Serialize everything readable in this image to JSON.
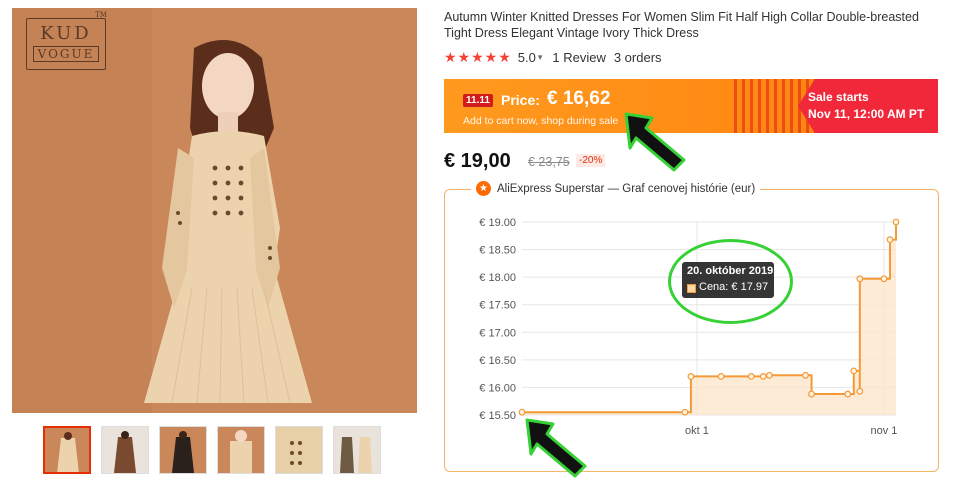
{
  "product": {
    "title": "Autumn Winter Knitted Dresses For Women Slim Fit Half High Collar Double-breasted Tight Dress Elegant Vintage Ivory Thick Dress",
    "brand_logo_top": "KUD",
    "brand_logo_bottom": "VOGUE",
    "brand_logo_mark": "TM",
    "rating_stars": "★★★★★",
    "rating_value": "5.0",
    "reviews": "1 Review",
    "orders": "3 orders",
    "thumbnails": [
      {
        "name": "thumb-1",
        "color": "#d9b48a"
      },
      {
        "name": "thumb-2",
        "color": "#7a4a30"
      },
      {
        "name": "thumb-3",
        "color": "#2a211c"
      },
      {
        "name": "thumb-4",
        "color": "#c9875a"
      },
      {
        "name": "thumb-5",
        "color": "#e7cfa8"
      },
      {
        "name": "thumb-6",
        "color": "#6f5a44"
      }
    ]
  },
  "sale_banner": {
    "tag": "11.11",
    "price_label": "Price:",
    "price_value": "€ 16,62",
    "subtitle": "Add to cart now, shop during sale",
    "sale_starts": "Sale starts",
    "sale_date": "Nov 11, 12:00 AM PT"
  },
  "pricing": {
    "current_price": "€ 19,00",
    "original_price": "€ 23,75",
    "discount": "-20%"
  },
  "price_history": {
    "badge_icon": "star-icon",
    "header": "AliExpress Superstar — Graf cenovej histórie (eur)",
    "tooltip_date": "20. október 2019",
    "tooltip_value": "Cena: € 17.97"
  },
  "colors": {
    "accent": "#ff9a1f",
    "sale_red": "#f0283a",
    "line": "#f29a38",
    "fill": "#fde6cc",
    "annotation": "#35d135"
  },
  "chart_data": {
    "type": "area",
    "title": "",
    "xlabel": "",
    "ylabel": "",
    "ylim": [
      15.5,
      19.0
    ],
    "yticks": [
      "€ 19.00",
      "€ 18.50",
      "€ 18.00",
      "€ 17.50",
      "€ 17.00",
      "€ 16.50",
      "€ 16.00",
      "€ 15.50"
    ],
    "xticks": [
      "okt 1",
      "nov 1"
    ],
    "x_range": [
      "2019-09-02",
      "2019-11-03"
    ],
    "series": [
      {
        "step": true,
        "points": [
          {
            "x": "2019-09-02",
            "y": 15.55
          },
          {
            "x": "2019-09-29",
            "y": 15.55
          },
          {
            "x": "2019-09-30",
            "y": 16.2
          },
          {
            "x": "2019-10-05",
            "y": 16.2
          },
          {
            "x": "2019-10-10",
            "y": 16.2
          },
          {
            "x": "2019-10-12",
            "y": 16.2
          },
          {
            "x": "2019-10-13",
            "y": 16.22
          },
          {
            "x": "2019-10-19",
            "y": 16.22
          },
          {
            "x": "2019-10-20",
            "y": 15.88
          },
          {
            "x": "2019-10-26",
            "y": 15.88
          },
          {
            "x": "2019-10-27",
            "y": 16.3
          },
          {
            "x": "2019-10-28",
            "y": 15.93
          },
          {
            "x": "2019-10-28",
            "y": 17.97
          },
          {
            "x": "2019-11-01",
            "y": 17.97
          },
          {
            "x": "2019-11-02",
            "y": 18.68
          },
          {
            "x": "2019-11-03",
            "y": 19.0
          }
        ]
      }
    ],
    "grid": true
  }
}
